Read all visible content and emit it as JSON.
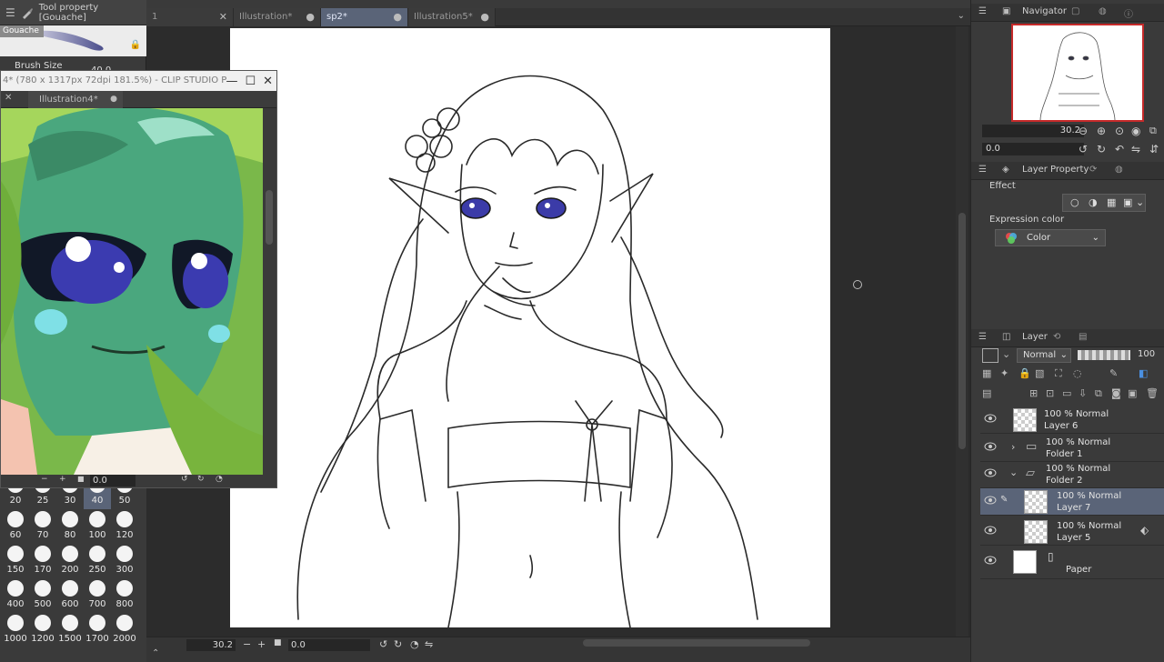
{
  "tool_property": {
    "title": "Tool property [Gouache]",
    "brush_name": "Gouache",
    "brush_size_label": "Brush Size",
    "brush_size_value": "40.0"
  },
  "brush_sizes": [
    {
      "label": "20"
    },
    {
      "label": "25"
    },
    {
      "label": "30"
    },
    {
      "label": "40",
      "selected": true
    },
    {
      "label": "50"
    },
    {
      "label": "60"
    },
    {
      "label": "70"
    },
    {
      "label": "80"
    },
    {
      "label": "100"
    },
    {
      "label": "120"
    },
    {
      "label": "150"
    },
    {
      "label": "170"
    },
    {
      "label": "200"
    },
    {
      "label": "250"
    },
    {
      "label": "300"
    },
    {
      "label": "400"
    },
    {
      "label": "500"
    },
    {
      "label": "600"
    },
    {
      "label": "700"
    },
    {
      "label": "800"
    },
    {
      "label": "1000"
    },
    {
      "label": "1200"
    },
    {
      "label": "1500"
    },
    {
      "label": "1700"
    },
    {
      "label": "2000"
    }
  ],
  "sub_window": {
    "title": "4* (780 x 1317px 72dpi 181.5%)  - CLIP STUDIO P",
    "tab": "Illustration4*",
    "rotation_value": "0.0"
  },
  "doc_tabs": [
    {
      "label": "1",
      "active": false
    },
    {
      "label": "Illustration*",
      "active": false
    },
    {
      "label": "sp2*",
      "active": true
    },
    {
      "label": "Illustration5*",
      "active": false
    }
  ],
  "canvas": {
    "zoom_value": "30.2",
    "rotation_value": "0.0"
  },
  "navigator": {
    "title": "Navigator",
    "zoom_value": "30.2",
    "rotation_value": "0.0"
  },
  "layer_property": {
    "title": "Layer Property",
    "effect_label": "Effect",
    "expression_color_label": "Expression color",
    "expression_color_value": "Color"
  },
  "layer_panel": {
    "title": "Layer",
    "blend_mode": "Normal",
    "opacity": "100",
    "layers": [
      {
        "mode": "100 % Normal",
        "name": "Layer 6",
        "kind": "layer",
        "selected": false
      },
      {
        "mode": "100 % Normal",
        "name": "Folder 1",
        "kind": "folder-closed",
        "selected": false
      },
      {
        "mode": "100 % Normal",
        "name": "Folder 2",
        "kind": "folder-open",
        "selected": false
      },
      {
        "mode": "100 % Normal",
        "name": "Layer 7",
        "kind": "layer",
        "selected": true
      },
      {
        "mode": "100 % Normal",
        "name": "Layer 5",
        "kind": "layer",
        "selected": false
      },
      {
        "mode": "",
        "name": "Paper",
        "kind": "paper",
        "selected": false
      }
    ]
  },
  "colors": {
    "selection": "#5a6478",
    "panel_bg": "#3a3a3a",
    "navigator_frame": "#c62a2a"
  }
}
